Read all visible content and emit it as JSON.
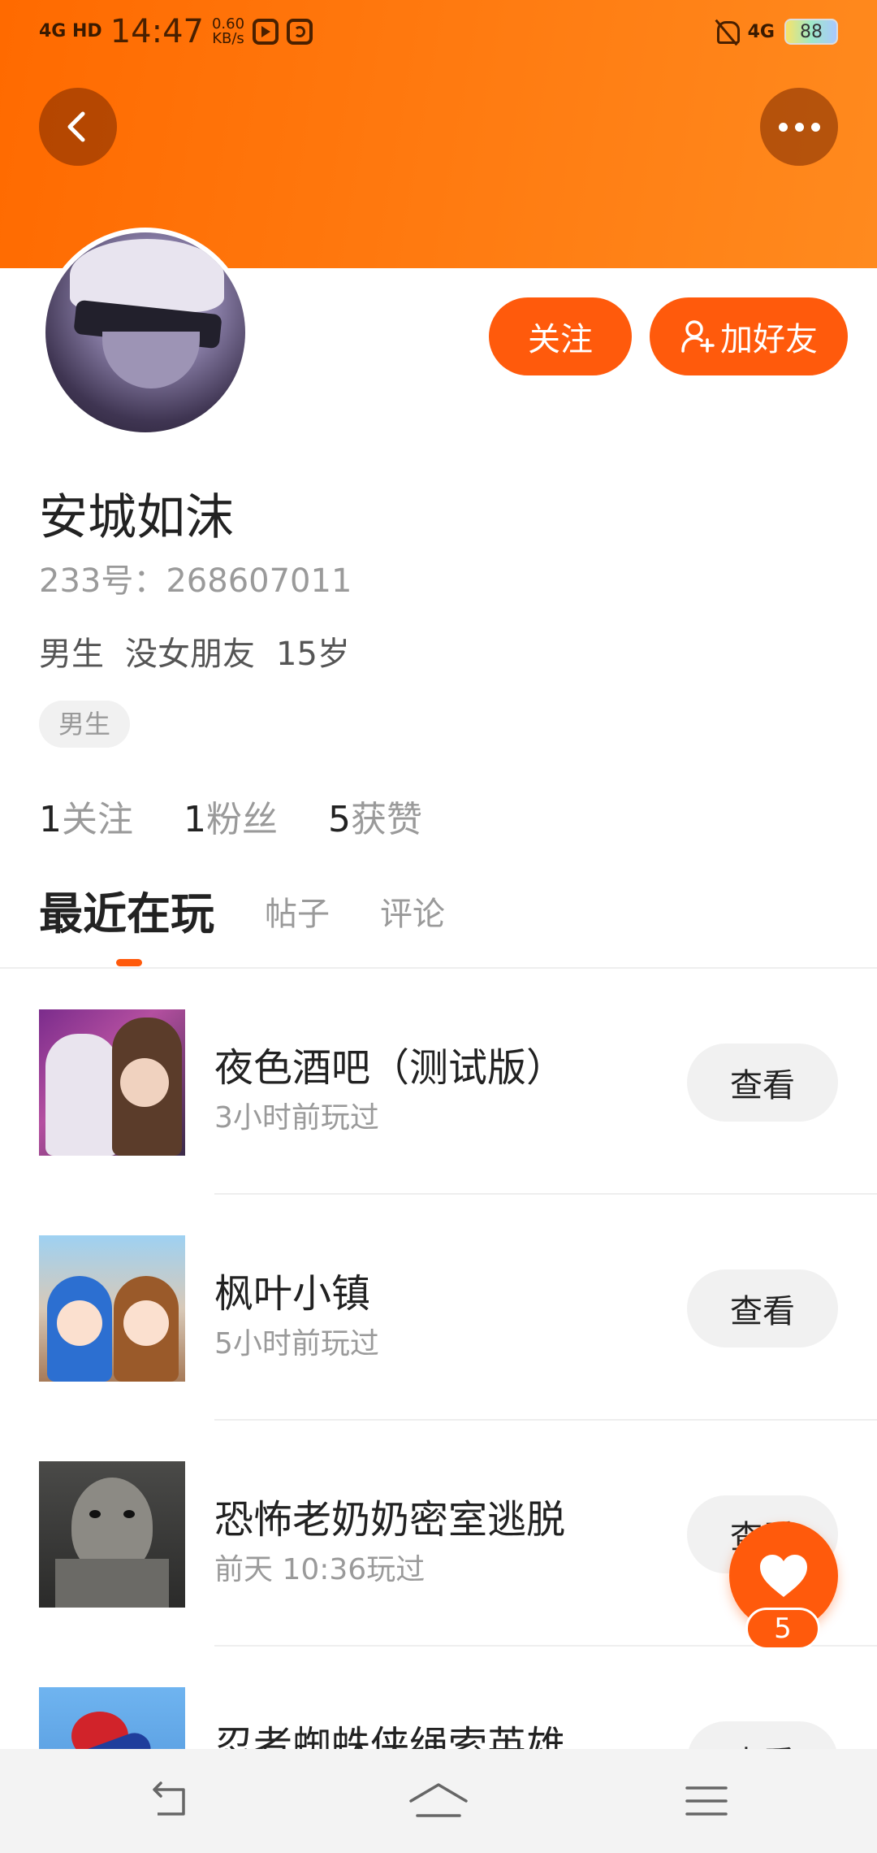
{
  "status_bar": {
    "network": "4G HD",
    "time": "14:47",
    "speed_value": "0.60",
    "speed_unit": "KB/s",
    "signal": "4G",
    "battery": "88"
  },
  "profile": {
    "follow_label": "关注",
    "add_friend_label": "加好友",
    "username": "安城如沫",
    "id_text": "233号：268607011",
    "info": [
      "男生",
      "没女朋友",
      "15岁"
    ],
    "tag": "男生",
    "stats": [
      {
        "num": "1",
        "label": "关注"
      },
      {
        "num": "1",
        "label": "粉丝"
      },
      {
        "num": "5",
        "label": "获赞"
      }
    ]
  },
  "tabs": [
    "最近在玩",
    "帖子",
    "评论"
  ],
  "games": [
    {
      "title": "夜色酒吧（测试版）",
      "time": "3小时前玩过",
      "button": "查看"
    },
    {
      "title": "枫叶小镇",
      "time": "5小时前玩过",
      "button": "查看"
    },
    {
      "title": "恐怖老奶奶密室逃脱",
      "time": "前天 10:36玩过",
      "button": "查看"
    },
    {
      "title": "忍者蜘蛛侠绳索英雄",
      "time": "",
      "button": "查看"
    }
  ],
  "like": {
    "count": "5"
  },
  "colors": {
    "accent": "#ff5a0c",
    "header": "#ff7a10"
  }
}
